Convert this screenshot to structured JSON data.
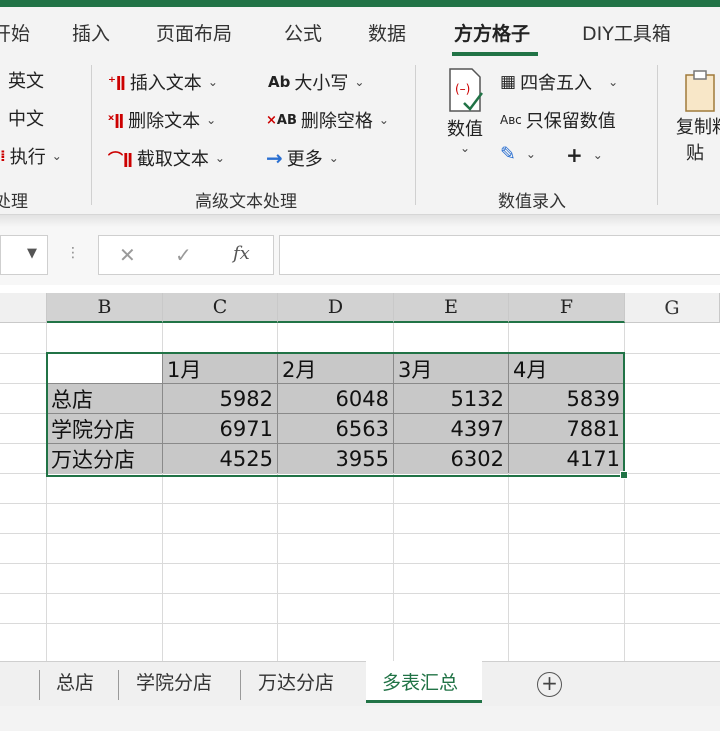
{
  "ribbon_tabs": [
    "开始",
    "插入",
    "页面布局",
    "公式",
    "数据",
    "方方格子",
    "DIY工具箱"
  ],
  "ribbon": {
    "group1": {
      "items": [
        "英文",
        "中文",
        "执行"
      ],
      "label": "处理"
    },
    "group2": {
      "insert_text": "插入文本",
      "delete_text": "删除文本",
      "cut_text": "截取文本",
      "case": "大小写",
      "delete_spaces": "删除空格",
      "more": "更多",
      "label": "高级文本处理"
    },
    "group3": {
      "value_button": "数值",
      "round": "四舍五入",
      "keep_values": "只保留数值",
      "label": "数值录入"
    },
    "group4": {
      "copy_paste_1": "复制粘",
      "copy_paste_2": "贴"
    }
  },
  "formula_bar": {
    "cancel": "✕",
    "confirm": "✓",
    "fx": "fx",
    "value": ""
  },
  "columns": [
    "B",
    "C",
    "D",
    "E",
    "F",
    "G"
  ],
  "table": {
    "headers": [
      "",
      "1月",
      "2月",
      "3月",
      "4月"
    ],
    "rows": [
      {
        "name": "总店",
        "values": [
          "5982",
          "6048",
          "5132",
          "5839"
        ]
      },
      {
        "name": "学院分店",
        "values": [
          "6971",
          "6563",
          "4397",
          "7881"
        ]
      },
      {
        "name": "万达分店",
        "values": [
          "4525",
          "3955",
          "6302",
          "4171"
        ]
      }
    ]
  },
  "sheets": [
    "总店",
    "学院分店",
    "万达分店",
    "多表汇总"
  ],
  "active_sheet": "多表汇总",
  "colors": {
    "accent": "#217346",
    "selected_fill": "#c8c8c8"
  }
}
